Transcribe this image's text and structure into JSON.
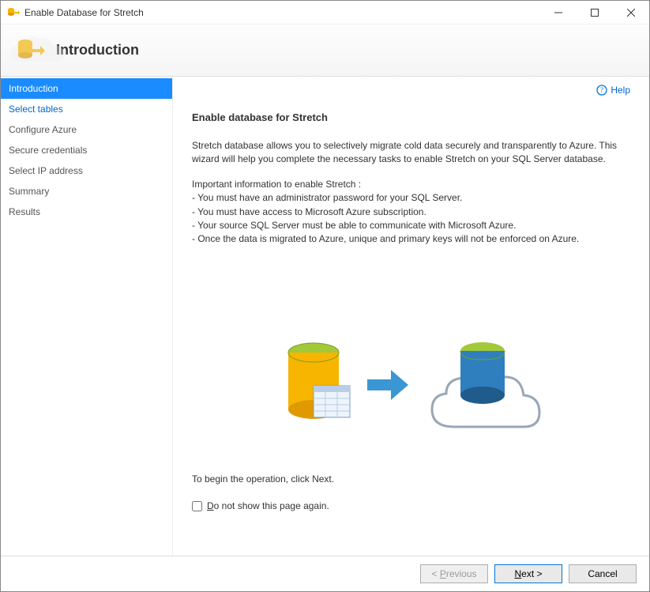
{
  "window": {
    "title": "Enable Database for Stretch"
  },
  "header": {
    "title": "Introduction"
  },
  "sidebar": {
    "items": [
      {
        "label": "Introduction",
        "state": "active"
      },
      {
        "label": "Select tables",
        "state": "link"
      },
      {
        "label": "Configure Azure",
        "state": "muted"
      },
      {
        "label": "Secure credentials",
        "state": "muted"
      },
      {
        "label": "Select IP address",
        "state": "muted"
      },
      {
        "label": "Summary",
        "state": "muted"
      },
      {
        "label": "Results",
        "state": "muted"
      }
    ]
  },
  "content": {
    "help": "Help",
    "heading": "Enable database for Stretch",
    "intro": "Stretch database allows you to selectively migrate cold data securely and transparently to Azure. This wizard will help you complete the necessary tasks to enable Stretch on your SQL Server database.",
    "important_label": "Important information to enable Stretch :",
    "bullets": [
      "- You must have an administrator password for your SQL Server.",
      "- You must have access to Microsoft Azure subscription.",
      "- Your source SQL Server must be able to communicate with Microsoft Azure.",
      "- Once the data is migrated to Azure, unique and primary keys will not be enforced on Azure."
    ],
    "begin": "To begin the operation, click Next.",
    "checkbox_label": "Do not show this page again."
  },
  "footer": {
    "previous": "< Previous",
    "next": "Next >",
    "cancel": "Cancel"
  }
}
